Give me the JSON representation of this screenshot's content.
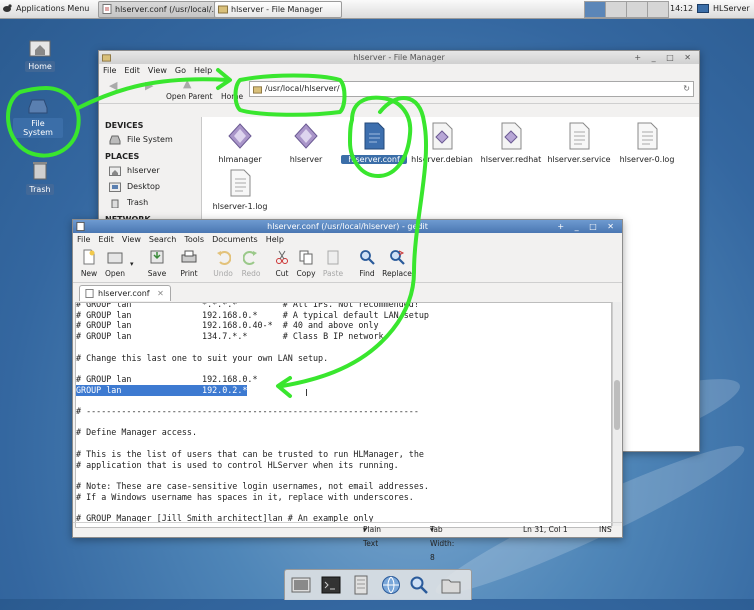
{
  "top_panel": {
    "apps_menu": "Applications Menu",
    "tasks": [
      {
        "label": "hlserver.conf (/usr/local/..."
      },
      {
        "label": "hlserver - File Manager"
      }
    ],
    "clock": "14:12",
    "user": "HLServer"
  },
  "desktop_icons": [
    {
      "label": "Home"
    },
    {
      "label": "File System"
    },
    {
      "label": "Trash"
    }
  ],
  "file_manager": {
    "title": "hlserver - File Manager",
    "menu": [
      "File",
      "Edit",
      "View",
      "Go",
      "Help"
    ],
    "toolbar": {
      "open_parent": "Open Parent",
      "home": "Home"
    },
    "location": "/usr/local/hlserver/",
    "sidebar": {
      "devices_header": "DEVICES",
      "devices": [
        "File System"
      ],
      "places_header": "PLACES",
      "places": [
        "hlserver",
        "Desktop",
        "Trash"
      ],
      "network_header": "NETWORK"
    },
    "files": [
      {
        "name": "hlmanager",
        "kind": "exec"
      },
      {
        "name": "hlserver",
        "kind": "exec"
      },
      {
        "name": "hlserver.conf",
        "kind": "conf"
      },
      {
        "name": "hlserver.debian",
        "kind": "script"
      },
      {
        "name": "hlserver.redhat",
        "kind": "script"
      },
      {
        "name": "hlserver.service",
        "kind": "text"
      },
      {
        "name": "hlserver-0.log",
        "kind": "text"
      },
      {
        "name": "hlserver-1.log",
        "kind": "text"
      }
    ]
  },
  "gedit": {
    "title": "hlserver.conf (/usr/local/hlserver) - gedit",
    "menu": [
      "File",
      "Edit",
      "View",
      "Search",
      "Tools",
      "Documents",
      "Help"
    ],
    "toolbar": [
      "New",
      "Open",
      "Save",
      "Print",
      "Undo",
      "Redo",
      "Cut",
      "Copy",
      "Paste",
      "Find",
      "Replace"
    ],
    "tab_label": "hlserver.conf",
    "lines": [
      "# GROUP lan              *.*.*.*         # All IPs. Not recommended!",
      "# GROUP lan              192.168.0.*     # A typical default LAN setup",
      "# GROUP lan              192.168.0.40-*  # 40 and above only",
      "# GROUP lan              134.7.*.*       # Class B IP network",
      "",
      "# Change this last one to suit your own LAN setup.",
      "",
      "# GROUP lan              192.168.0.*",
      "GROUP lan                192.0.2.*",
      "",
      "# ------------------------------------------------------------------",
      "",
      "# Define Manager access.",
      "",
      "# This is the list of users that can be trusted to run HLManager, the",
      "# application that is used to control HLServer when its running.",
      "",
      "# Note: These are case-sensitive login usernames, not email addresses.",
      "# If a Windows username has spaces in it, replace with underscores.",
      "",
      "# GROUP Manager [Jill Smith architect]lan # An example only"
    ],
    "status": {
      "syntax": "Plain Text",
      "tab_width": "Tab Width: 8",
      "position": "Ln 31, Col 1",
      "mode": "INS"
    }
  },
  "dock": [
    "files-icon",
    "terminal-icon",
    "filer-icon",
    "browser-icon",
    "search-icon",
    "folder-icon"
  ],
  "colors": {
    "selection": "#3d7ad1",
    "annotation": "#39e62e",
    "titlebar": "#4a77b2"
  }
}
